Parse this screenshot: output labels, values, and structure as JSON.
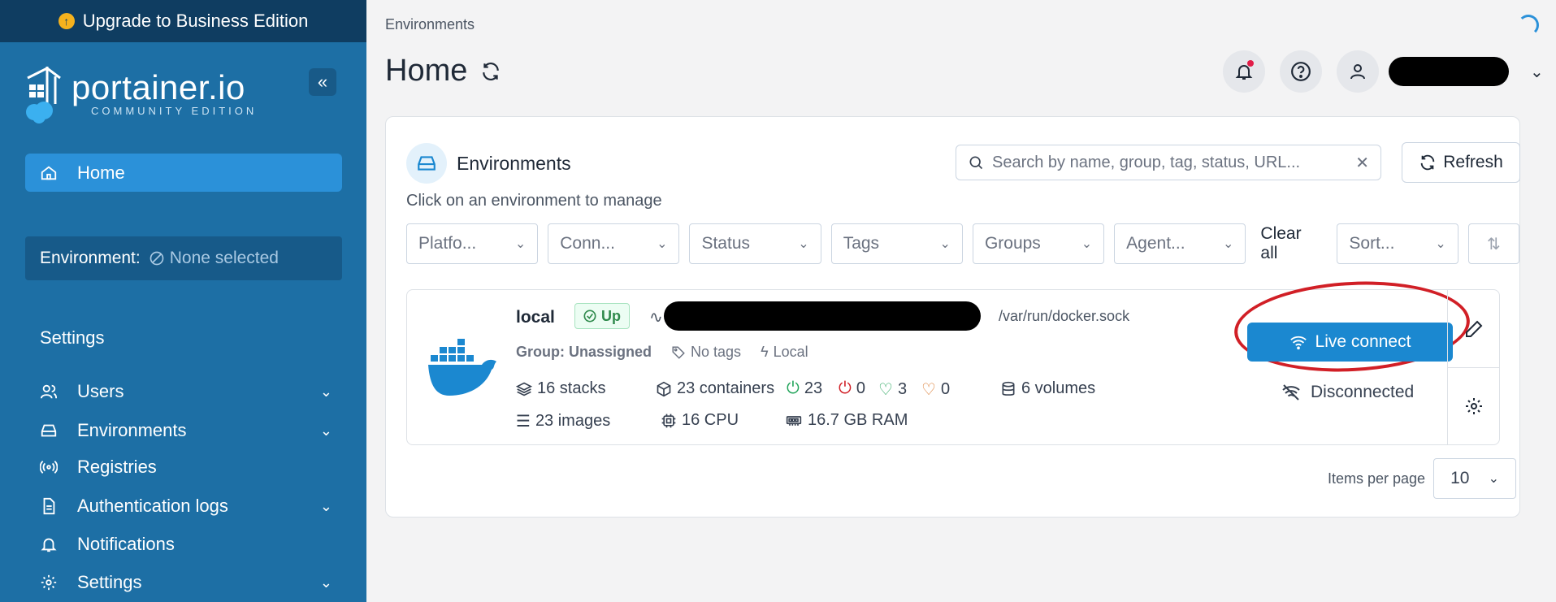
{
  "sidebar": {
    "upgrade_label": "Upgrade to Business Edition",
    "brand": "portainer.io",
    "edition": "COMMUNITY EDITION",
    "home_label": "Home",
    "environment_label": "Environment:",
    "environment_value": "None selected",
    "settings_section": "Settings",
    "items": [
      {
        "label": "Users",
        "icon": "users-icon",
        "has_chevron": true
      },
      {
        "label": "Environments",
        "icon": "hard-drive-icon",
        "has_chevron": true
      },
      {
        "label": "Registries",
        "icon": "broadcast-icon",
        "has_chevron": false
      },
      {
        "label": "Authentication logs",
        "icon": "file-icon",
        "has_chevron": true
      },
      {
        "label": "Notifications",
        "icon": "bell-icon",
        "has_chevron": false
      },
      {
        "label": "Settings",
        "icon": "gear-icon",
        "has_chevron": true
      }
    ]
  },
  "header": {
    "breadcrumb": "Environments",
    "title": "Home"
  },
  "panel": {
    "title": "Environments",
    "subtitle": "Click on an environment to manage",
    "search_placeholder": "Search by name, group, tag, status, URL...",
    "refresh_label": "Refresh",
    "filters": [
      "Platfo...",
      "Conn...",
      "Status",
      "Tags",
      "Groups",
      "Agent..."
    ],
    "clear_all": "Clear all",
    "sort_label": "Sort..."
  },
  "environment": {
    "name": "local",
    "status": "Up",
    "socket": "/var/run/docker.sock",
    "group": "Group: Unassigned",
    "tags": "No tags",
    "type": "Local",
    "stacks": "16 stacks",
    "containers": "23 containers",
    "running": "23",
    "stopped": "0",
    "healthy": "3",
    "unhealthy": "0",
    "volumes": "6 volumes",
    "images": "23 images",
    "cpu": "16 CPU",
    "ram": "16.7 GB RAM",
    "live_connect": "Live connect",
    "connection_state": "Disconnected"
  },
  "pagination": {
    "label": "Items per page",
    "value": "10"
  },
  "colors": {
    "sidebar": "#1d6fa5",
    "sidebar_dark": "#0f3d61",
    "accent": "#1b88d0",
    "annotation": "#d11f26"
  }
}
